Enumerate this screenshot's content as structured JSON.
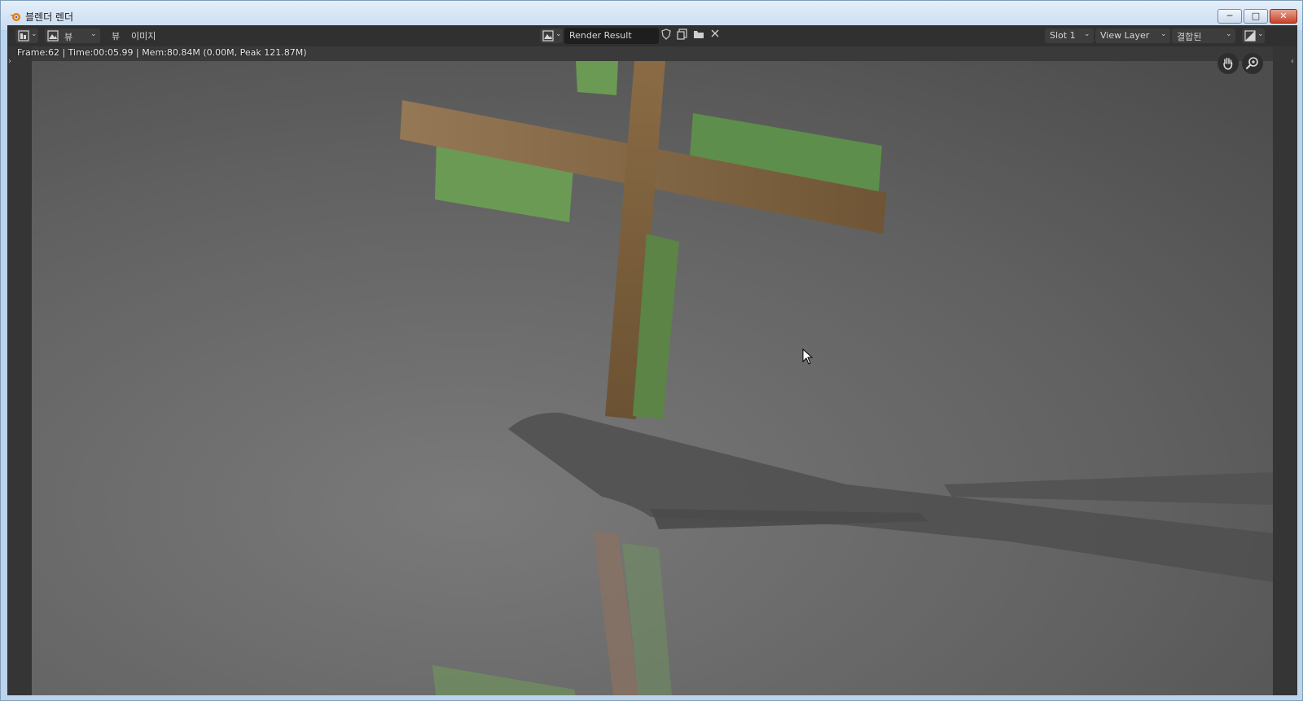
{
  "window": {
    "title": "블렌더 렌더",
    "controls": {
      "minimize": "─",
      "maximize": "□",
      "close": "✕"
    }
  },
  "header": {
    "editor_type_icon": "image-editor-icon",
    "view_mode_icon": "image-view-icon",
    "view_mode_value": "뷰",
    "menus": [
      "뷰",
      "이미지"
    ],
    "image_browse_icon": "image-browse-icon",
    "image_name": "Render Result",
    "fake_user_icon": "shield-icon",
    "duplicate_icon": "duplicate-icon",
    "open_icon": "folder-icon",
    "unlink_icon": "close-icon",
    "slot": "Slot 1",
    "view_layer": "View Layer",
    "pass": "결합된",
    "display_channels_icon": "color-channels-icon"
  },
  "viewport": {
    "status": "Frame:62 | Time:00:05.99 | Mem:80.84M (0.00M, Peak 121.87M)",
    "nav_icons": [
      "hand-icon",
      "zoom-icon"
    ]
  },
  "colors": {
    "header_bg": "#303030",
    "field_bg": "#1e1e1e",
    "wood": "#8a6b45",
    "green": "#6b9a55",
    "floor": "#6a6a6a"
  }
}
